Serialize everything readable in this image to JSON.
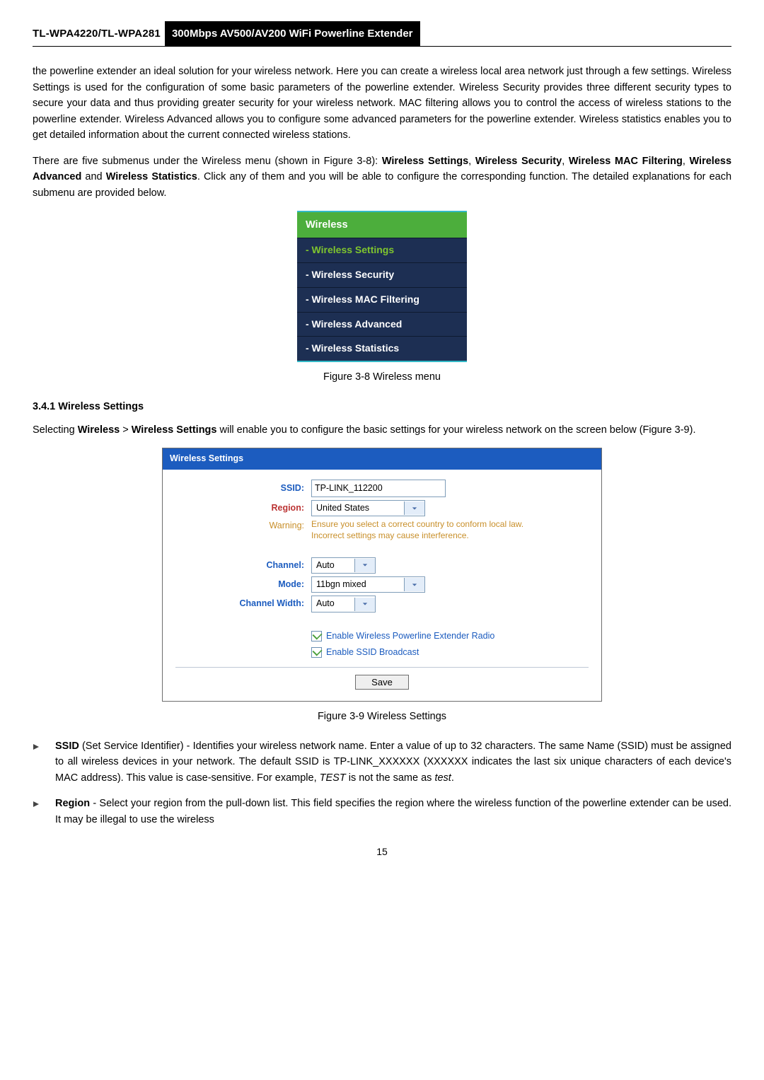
{
  "header": {
    "model": "TL-WPA4220/TL-WPA281",
    "subtitle": "300Mbps AV500/AV200 WiFi Powerline Extender"
  },
  "para1": "the powerline extender an ideal solution for your wireless network. Here you can create a wireless local area network just through a few settings. Wireless Settings is used for the configuration of some basic parameters of the powerline extender. Wireless Security provides three different security types to secure your data and thus providing greater security for your wireless network. MAC filtering allows you to control the access of wireless stations to the powerline extender. Wireless Advanced allows you to configure some advanced parameters for the powerline extender. Wireless statistics enables you to get detailed information about the current connected wireless stations.",
  "para2_pre": "There are five submenus under the Wireless menu (shown in Figure 3-8): ",
  "para2_items": [
    "Wireless Settings",
    "Wireless Security",
    "Wireless MAC Filtering",
    "Wireless Advanced",
    "Wireless Statistics"
  ],
  "para2_post": ". Click any of them and you will be able to configure the corresponding function. The detailed explanations for each submenu are provided below.",
  "submenu": {
    "head": "Wireless",
    "items": [
      "- Wireless Settings",
      "- Wireless Security",
      "- Wireless MAC Filtering",
      "- Wireless Advanced",
      "- Wireless Statistics"
    ]
  },
  "fig38": "Figure 3-8 Wireless menu",
  "section_title": "3.4.1 Wireless Settings",
  "para3_pre": "Selecting ",
  "para3_b1": "Wireless",
  "para3_mid": " > ",
  "para3_b2": "Wireless Settings",
  "para3_post": " will enable you to configure the basic settings for your wireless network on the screen below (Figure 3-9).",
  "form": {
    "title": "Wireless Settings",
    "ssid_label": "SSID:",
    "ssid_value": "TP-LINK_112200",
    "region_label": "Region:",
    "region_value": "United States",
    "warning_label": "Warning:",
    "warning_line1": "Ensure you select a correct country to conform local law.",
    "warning_line2": "Incorrect settings may cause interference.",
    "channel_label": "Channel:",
    "channel_value": "Auto",
    "mode_label": "Mode:",
    "mode_value": "11bgn mixed",
    "cw_label": "Channel Width:",
    "cw_value": "Auto",
    "cb1": "Enable Wireless Powerline Extender Radio",
    "cb2": "Enable SSID Broadcast",
    "save": "Save"
  },
  "fig39": "Figure 3-9 Wireless Settings",
  "bullet1": {
    "head": "SSID",
    "rest": " (Set Service Identifier) - Identifies your wireless network name. Enter a value of up to 32 characters. The same Name (SSID) must be assigned to all wireless devices in your network. The default SSID is TP-LINK_XXXXXX (XXXXXX indicates the last six unique characters of each device's MAC address). This value is case-sensitive. For example, ",
    "i1": "TEST",
    "mid": " is not the same as ",
    "i2": "test",
    "end": "."
  },
  "bullet2": {
    "head": "Region",
    "rest": " - Select your region from the pull-down list. This field specifies the region where the wireless function of the powerline extender can be used. It may be illegal to use the wireless"
  },
  "and": " and ",
  "comma": ", ",
  "pagenum": "15"
}
